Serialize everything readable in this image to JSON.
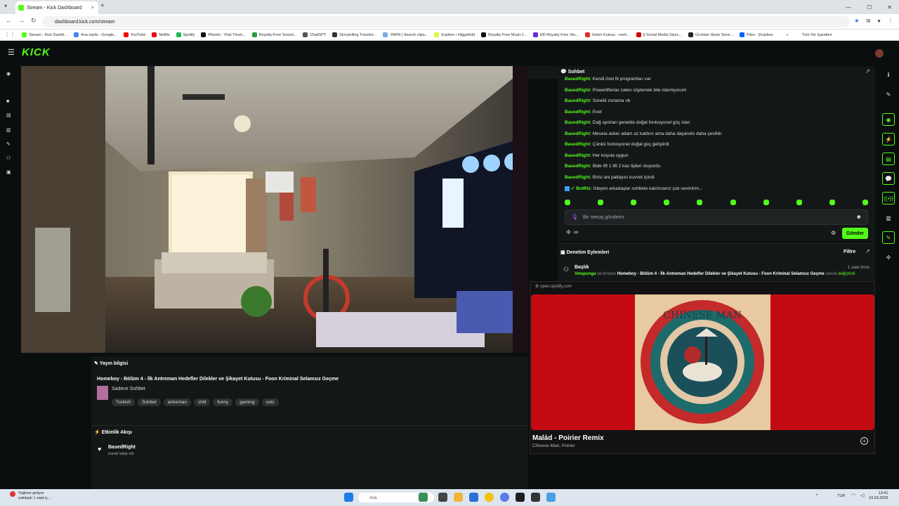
{
  "browser": {
    "tab_title": "Stream - Kick Dashboard",
    "tab_close": "×",
    "new_tab": "+",
    "url": "dashboard.kick.com/stream",
    "bookmarks": [
      {
        "label": "Stream - Kick Dashb...",
        "color": "#53fc18"
      },
      {
        "label": "Ana sayfa - Google...",
        "color": "#4285f4"
      },
      {
        "label": "YouTube",
        "color": "#ff0000"
      },
      {
        "label": "Netflix",
        "color": "#e50914"
      },
      {
        "label": "Spotify",
        "color": "#1db954"
      },
      {
        "label": "Pikzels - Viral Thum...",
        "color": "#111111"
      },
      {
        "label": "Royalty-Free Sound...",
        "color": "#2c9c48"
      },
      {
        "label": "ChatGPT",
        "color": "#555555"
      },
      {
        "label": "Storytelling Transfor...",
        "color": "#333333"
      },
      {
        "label": "YARN | Search clips...",
        "color": "#7ad"
      },
      {
        "label": "Explore • Higgsfield",
        "color": "#d4ff3a"
      },
      {
        "label": "Royalty Free Music f...",
        "color": "#111"
      },
      {
        "label": "HD Royalty Free Sto...",
        "color": "#6a2bd9"
      },
      {
        "label": "Gelen Kutusu - mert...",
        "color": "#d93025"
      },
      {
        "label": "|| Social Media Sizec...",
        "color": "#c00"
      },
      {
        "label": "Ücretsiz Hisse Sene...",
        "color": "#222"
      },
      {
        "label": "Files - Dropbox",
        "color": "#0061ff"
      }
    ],
    "bookmarks_more": "»",
    "all_bookmarks": "Tüm Yer İşaretleri"
  },
  "kick": {
    "logo": "KICK"
  },
  "stream_info": {
    "header": "Yayın bilgisi",
    "title": "Homeboy - Bölüm 4 - İlk Antreman Hedefler Dilekler ve Şikayet Kutusu - Foon Kriminal Selamsız Geçme",
    "category": "Sadece Sohbet",
    "tags": [
      "Turkish",
      "Sohbet",
      "antreman",
      "chill",
      "funny",
      "gaming",
      "solo"
    ]
  },
  "activity": {
    "header": "Etkinlik Akışı",
    "user": "BasedRight",
    "action": "kanalı takip etti"
  },
  "chat": {
    "header": "Sohbet",
    "messages": [
      {
        "user": "BasedRight",
        "text": "Kendi özel fit programları var"
      },
      {
        "user": "BasedRight",
        "text": "Powerlifterlar zaten söylemek bile istemiyorum"
      },
      {
        "user": "BasedRight",
        "text": "Sürekli zorlama vb"
      },
      {
        "user": "BasedRight",
        "text": "Evet"
      },
      {
        "user": "BasedRight",
        "text": "Dağ sporları genelde doğal fonksiyonel güç ister"
      },
      {
        "user": "BasedRight",
        "text": "Mesela asker adam az kaldırır ama daha dayanıklı daha çeviktir"
      },
      {
        "user": "BasedRight",
        "text": "Çünkü fonksiyonel doğal güç geliştirdi"
      },
      {
        "user": "BasedRight",
        "text": "Her koşula uygun"
      },
      {
        "user": "BasedRight",
        "text": "Bide lift 1 lift 2 kas tipleri oluyordu"
      },
      {
        "user": "BasedRight",
        "text": "Birisi ani patlayıcı kuvvet içindi"
      }
    ],
    "bot_message": {
      "user": "BotRix",
      "text": "İzleyen arkadaşlar sohbete katılırsanız çok sevinirim..."
    },
    "input_placeholder": "Bir mesaj gönderin",
    "send_label": "Gönder",
    "infinity": "∞"
  },
  "moderation": {
    "header": "Denetim Eylemleri",
    "filter": "Filtre",
    "item_title": "Başlık",
    "item_time": "1 saat önce",
    "item_user": "Vetapunga",
    "item_by": "tarafından",
    "item_text": "Homeboy - Bölüm 4 - İlk Antreman Hedefler Dilekler ve Şikayet Kutusu - Foon Kriminal Selamsız Geçme",
    "item_suffix": "olarak",
    "item_action": "değiştirdi"
  },
  "spotify": {
    "url": "open.spotify.com",
    "song": "Malád - Poirier Remix",
    "artists": "Chinese Man, Poirier",
    "cover_text": "CHINESE MAN"
  },
  "taskbar": {
    "weather_title": "Yağmur geliyor",
    "weather_sub": "yaklaşık 1 saat iç...",
    "search": "Ara",
    "lang": "TUR",
    "time": "13:41",
    "date": "24.03.2026"
  },
  "colors": {
    "accent": "#53fc18",
    "spotify_red": "#c40b13"
  }
}
